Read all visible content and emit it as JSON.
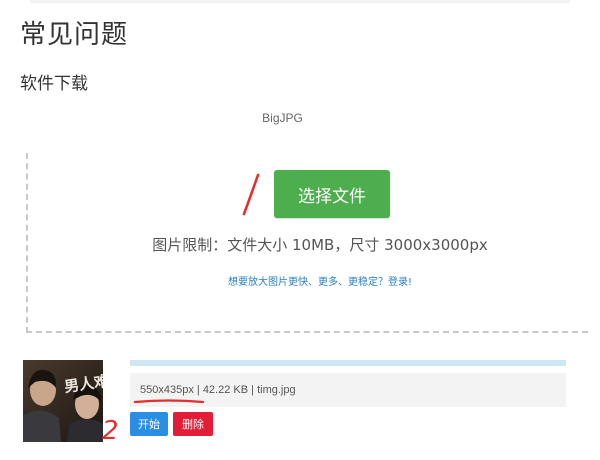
{
  "page": {
    "title": "常见问题",
    "section": "软件下载"
  },
  "uploader": {
    "brand": "BigJPG",
    "choose_button": "选择文件",
    "limit_text": "图片限制：文件大小 10MB，尺寸 3000x3000px",
    "promo_link": "想要放大图片更快、更多、更稳定？登录!"
  },
  "file_item": {
    "dimensions": "550x435px",
    "size": "42.22 KB",
    "filename": "timg.jpg",
    "start_button": "开始",
    "delete_button": "删除",
    "thumbnail_text": "男人难"
  },
  "annotations": {
    "mark_2": "2"
  },
  "colors": {
    "choose_button": "#4cae4c",
    "start_button": "#2b8ee5",
    "delete_button": "#e21d36",
    "annotation": "#e03030",
    "progress": "#cfe6f5"
  }
}
